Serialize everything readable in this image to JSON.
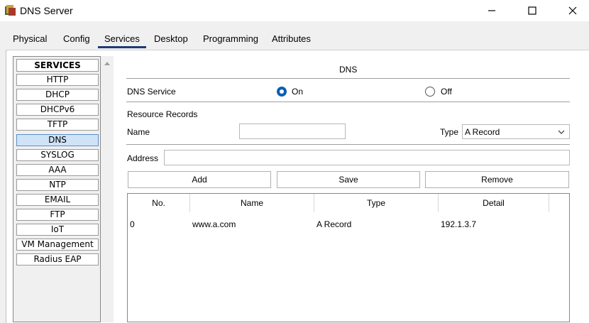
{
  "window": {
    "title": "DNS Server",
    "minimize": "–",
    "maximize": "☐",
    "close": "✕"
  },
  "tabs": [
    {
      "label": "Physical"
    },
    {
      "label": "Config"
    },
    {
      "label": "Services",
      "active": true
    },
    {
      "label": "Desktop"
    },
    {
      "label": "Programming"
    },
    {
      "label": "Attributes"
    }
  ],
  "services": {
    "header": "SERVICES",
    "items": [
      "HTTP",
      "DHCP",
      "DHCPv6",
      "TFTP",
      "DNS",
      "SYSLOG",
      "AAA",
      "NTP",
      "EMAIL",
      "FTP",
      "IoT",
      "VM Management",
      "Radius EAP"
    ],
    "selected": "DNS"
  },
  "dns": {
    "heading": "DNS",
    "service_label": "DNS Service",
    "on_label": "On",
    "off_label": "Off",
    "service_state": "On",
    "resource_records_label": "Resource Records",
    "name_label": "Name",
    "name_value": "",
    "type_label": "Type",
    "type_value": "A Record",
    "address_label": "Address",
    "address_value": "",
    "add_label": "Add",
    "save_label": "Save",
    "remove_label": "Remove"
  },
  "table": {
    "columns": [
      "No.",
      "Name",
      "Type",
      "Detail"
    ],
    "rows": [
      {
        "no": "0",
        "name": "www.a.com",
        "type": "A Record",
        "detail": "192.1.3.7"
      }
    ]
  },
  "colors": {
    "accent": "#0a5fb4",
    "tab_underline": "#1f3b73",
    "selected_service": "#cfe3f7"
  }
}
